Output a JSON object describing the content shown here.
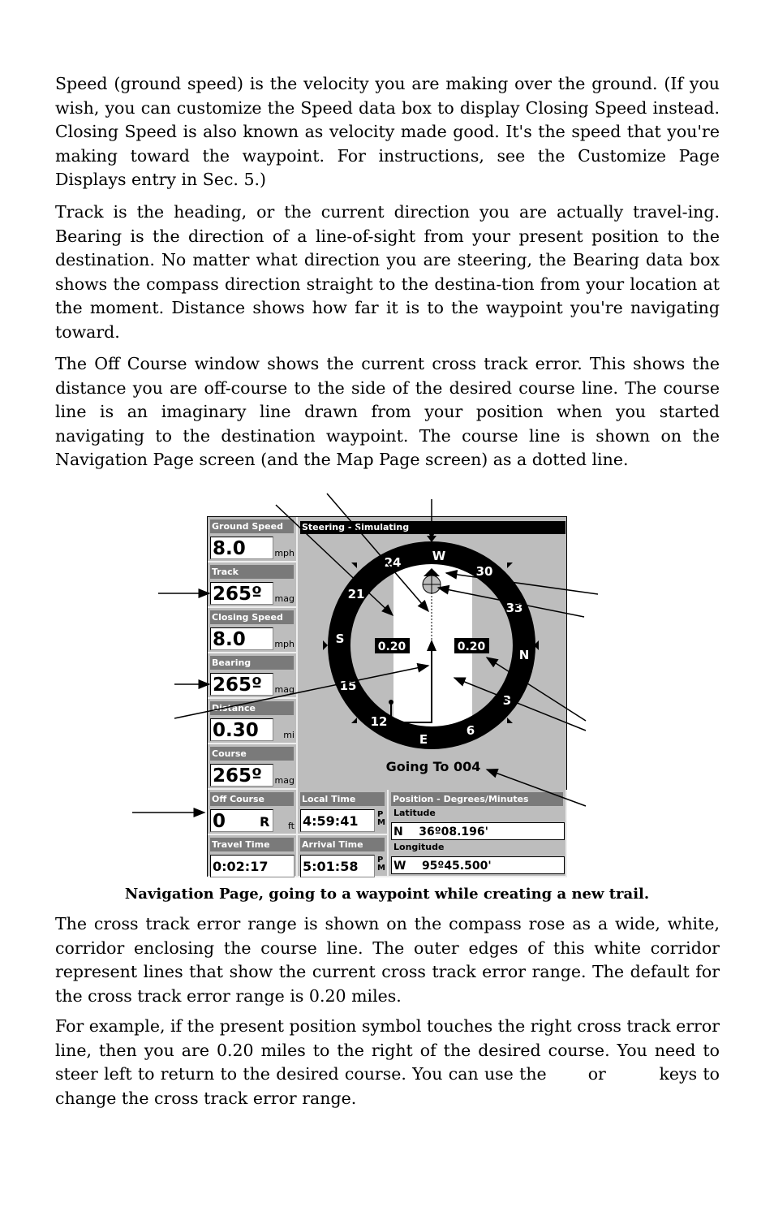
{
  "paragraphs": [
    "Speed (ground speed) is the velocity you are making over the ground. (If you wish, you can customize the Speed data box to display Closing Speed instead. Closing Speed is also known as velocity made good. It's the speed that you're making toward the waypoint. For instructions, see the Customize Page Displays entry in Sec. 5.)",
    "Track is the heading, or the current direction you are actually travel-ing. Bearing is the direction of a line-of-sight from your present position to the destination. No matter what direction you are steering, the Bearing data box shows the compass direction straight to the destina-tion from your location at the moment. Distance shows how far it is to the waypoint you're navigating toward.",
    "The Off Course window shows the current cross track error. This shows the distance you are off-course to the side of the desired course line. The course line is an imaginary line drawn from your position when you started navigating to the destination waypoint. The course line is shown on the Navigation Page screen (and the Map Page screen) as a dotted line.",
    "The cross track error range is shown on the compass rose as a wide, white, corridor enclosing the course line. The outer edges of this white corridor represent lines that show the current cross track error range. The default for the cross track error range is 0.20 miles.",
    "For example, if the present position symbol touches the right cross track error line, then you are 0.20 miles to the right of the desired course. You need to steer left to return to the desired course. You can use the       or         keys to change the cross track error range."
  ],
  "caption": "Navigation Page, going to a waypoint while creating a new trail.",
  "gps": {
    "boxes": [
      {
        "label": "Ground Speed",
        "value": "8.0",
        "unit": "mph"
      },
      {
        "label": "Track",
        "value": "265º",
        "unit": "mag"
      },
      {
        "label": "Closing Speed",
        "value": "8.0",
        "unit": "mph"
      },
      {
        "label": "Bearing",
        "value": "265º",
        "unit": "mag"
      },
      {
        "label": "Distance",
        "value": "0.30",
        "unit": "mi"
      },
      {
        "label": "Course",
        "value": "265º",
        "unit": "mag"
      },
      {
        "label": "Off Course",
        "value": "0",
        "side": "R",
        "unit": "ft"
      },
      {
        "label": "Travel Time",
        "value": "0:02:17"
      },
      {
        "label": "Local Time",
        "value": "4:59:41",
        "ampm": "P M"
      },
      {
        "label": "Arrival Time",
        "value": "5:01:58",
        "ampm": "P M"
      }
    ],
    "title": "Steering - Simulating",
    "compass_labels": [
      "W",
      "24",
      "30",
      "21",
      "33",
      "S",
      "N",
      "15",
      "3",
      "12",
      "E",
      "6"
    ],
    "xte_left": "0.20",
    "xte_right": "0.20",
    "going_to": "Going To 004",
    "position": {
      "title": "Position - Degrees/Minutes",
      "lat_label": "Latitude",
      "lat": "N    36º08.196'",
      "lon_label": "Longitude",
      "lon": "W    95º45.500'"
    }
  }
}
